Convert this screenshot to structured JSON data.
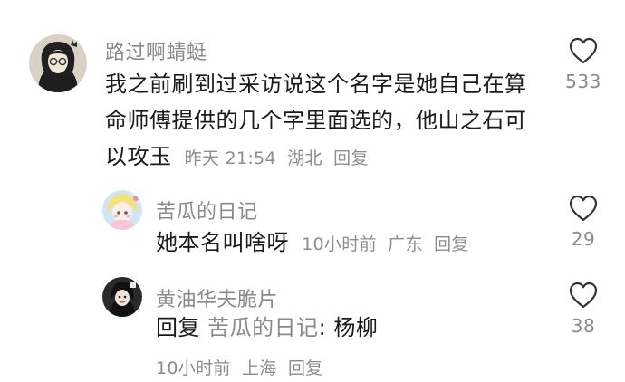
{
  "comments": [
    {
      "username": "路过啊蜻蜓",
      "lines": [
        "我之前刷到过采访说这个名字是她自己在算",
        "命师傅提供的几个字里面选的，他山之石可",
        "以攻玉"
      ],
      "time": "昨天 21:54",
      "location": "湖北",
      "reply": "回复",
      "likes": "533"
    },
    {
      "username": "苦瓜的日记",
      "text": "她本名叫啥呀",
      "time": "10小时前",
      "location": "广东",
      "reply": "回复",
      "likes": "29"
    },
    {
      "username": "黄油华夫脆片",
      "reply_label": "回复",
      "reply_to": "苦瓜的日记",
      "text": ": 杨柳",
      "time": "10小时前",
      "location": "上海",
      "reply": "回复",
      "likes": "38"
    }
  ],
  "icons": {
    "like": "heart-outline-icon"
  },
  "colors": {
    "primary_text": "#1a1a1a",
    "secondary_text": "#8a8a8a",
    "background": "#ffffff"
  }
}
